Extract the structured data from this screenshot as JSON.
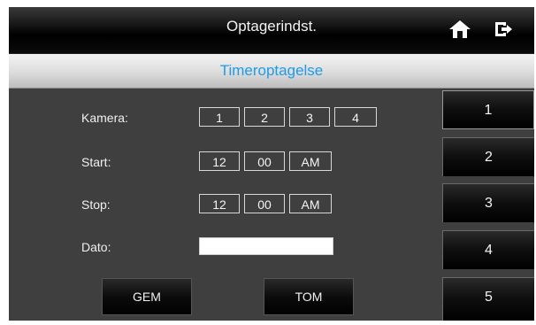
{
  "header": {
    "title": "Optagerindst.",
    "home_icon": "home-icon",
    "exit_icon": "exit-icon"
  },
  "subheader": {
    "title": "Timeroptagelse",
    "color": "#1e9be8"
  },
  "form": {
    "camera": {
      "label": "Kamera:",
      "options": [
        "1",
        "2",
        "3",
        "4"
      ]
    },
    "start": {
      "label": "Start:",
      "hour": "12",
      "minute": "00",
      "ampm": "AM"
    },
    "stop": {
      "label": "Stop:",
      "hour": "12",
      "minute": "00",
      "ampm": "AM"
    },
    "date": {
      "label": "Dato:",
      "value": ""
    }
  },
  "buttons": {
    "save": "GEM",
    "clear": "TOM"
  },
  "sidebar": {
    "items": [
      "1",
      "2",
      "3",
      "4",
      "5"
    ],
    "selected": "1"
  }
}
